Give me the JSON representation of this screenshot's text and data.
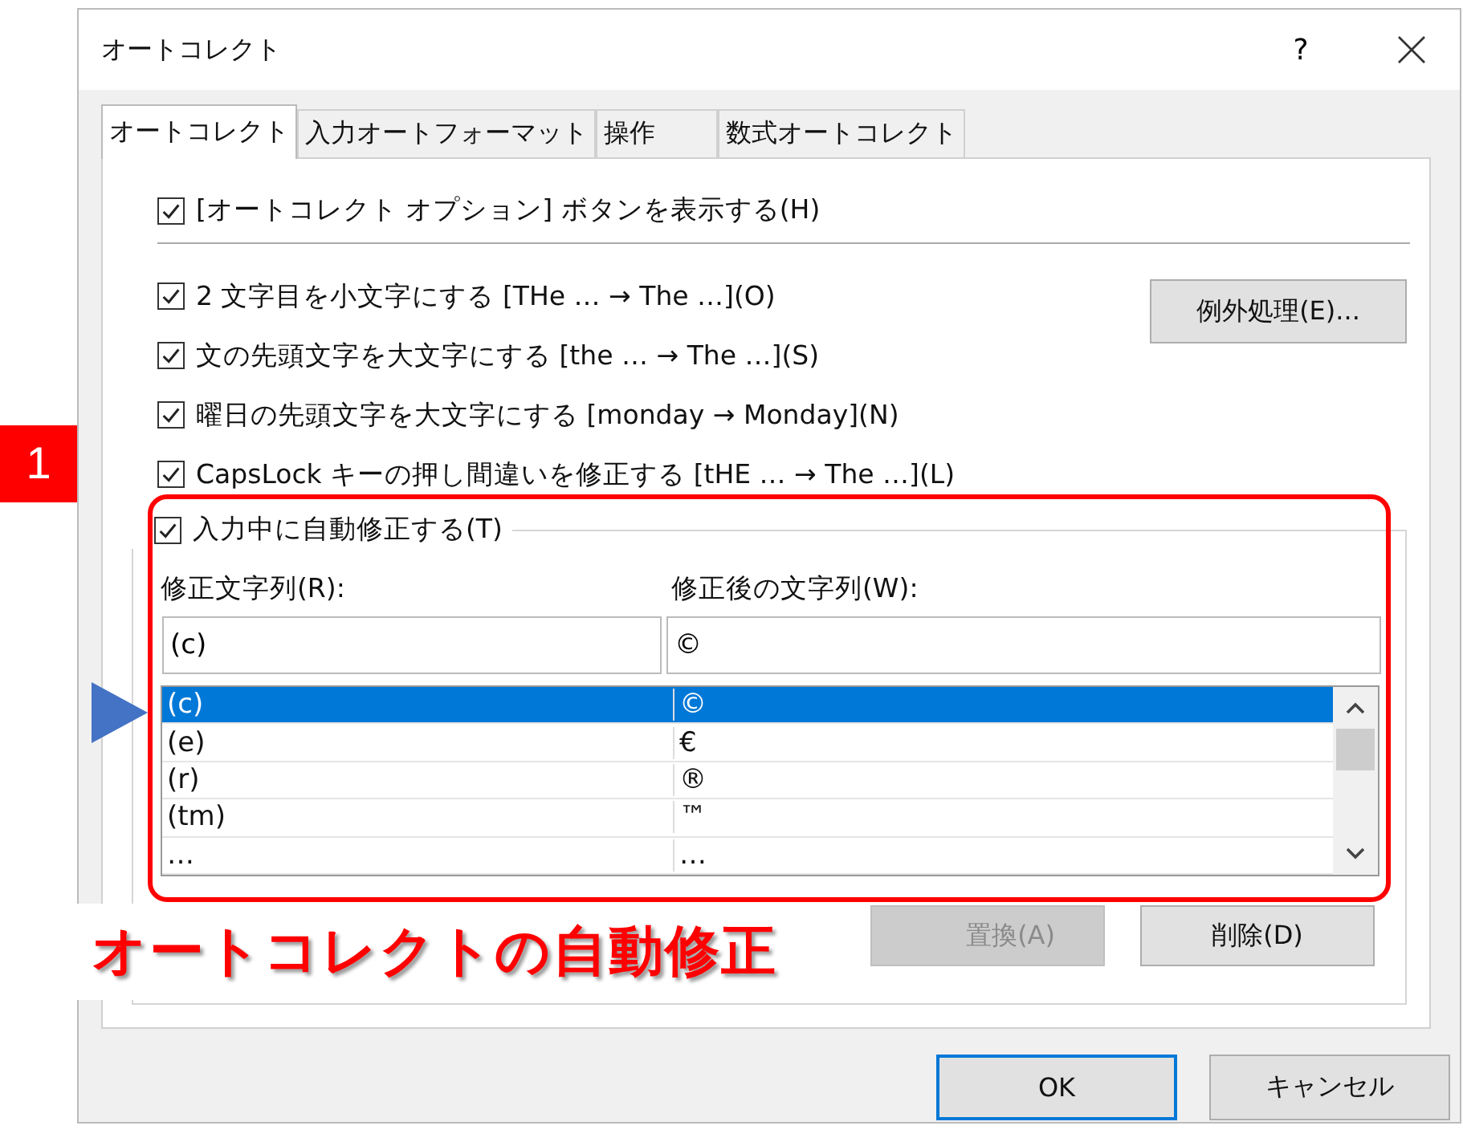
{
  "window": {
    "title": "オートコレクト",
    "help": "?"
  },
  "tabs": [
    {
      "label": "オートコレクト",
      "selected": true
    },
    {
      "label": "入力オートフォーマット",
      "selected": false
    },
    {
      "label": "操作",
      "selected": false
    },
    {
      "label": "数式オートコレクト",
      "selected": false
    }
  ],
  "show_button_option": {
    "label": "[オートコレクト オプション] ボタンを表示する(H)",
    "checked": true
  },
  "rules": [
    {
      "label": "2 文字目を小文字にする [THe … → The …](O)",
      "checked": true
    },
    {
      "label": "文の先頭文字を大文字にする [the … → The …](S)",
      "checked": true
    },
    {
      "label": "曜日の先頭文字を大文字にする [monday → Monday](N)",
      "checked": true
    },
    {
      "label": "CapsLock キーの押し間違いを修正する [tHE … → The …](L)",
      "checked": true
    }
  ],
  "exceptions_button": "例外処理(E)...",
  "replace_as_you_type": {
    "label": "入力中に自動修正する(T)",
    "checked": true
  },
  "replace_label": "修正文字列(R):",
  "with_label": "修正後の文字列(W):",
  "replace_value": "(c)",
  "with_value": "©",
  "entries": [
    {
      "replace": "(c)",
      "with": "©",
      "selected": true
    },
    {
      "replace": "(e)",
      "with": "€",
      "selected": false
    },
    {
      "replace": "(r)",
      "with": "®",
      "selected": false
    },
    {
      "replace": "(tm)",
      "with": "™",
      "selected": false
    },
    {
      "replace": "…",
      "with": "…",
      "selected": false
    }
  ],
  "replace_button": {
    "label": "置換(A)",
    "disabled": true
  },
  "delete_button": {
    "label": "削除(D)",
    "disabled": false
  },
  "buttons": [
    {
      "label": "OK",
      "default": true
    },
    {
      "label": "キャンセル",
      "default": false
    }
  ],
  "annotations": {
    "badge": "1",
    "caption": "オートコレクトの自動修正"
  }
}
